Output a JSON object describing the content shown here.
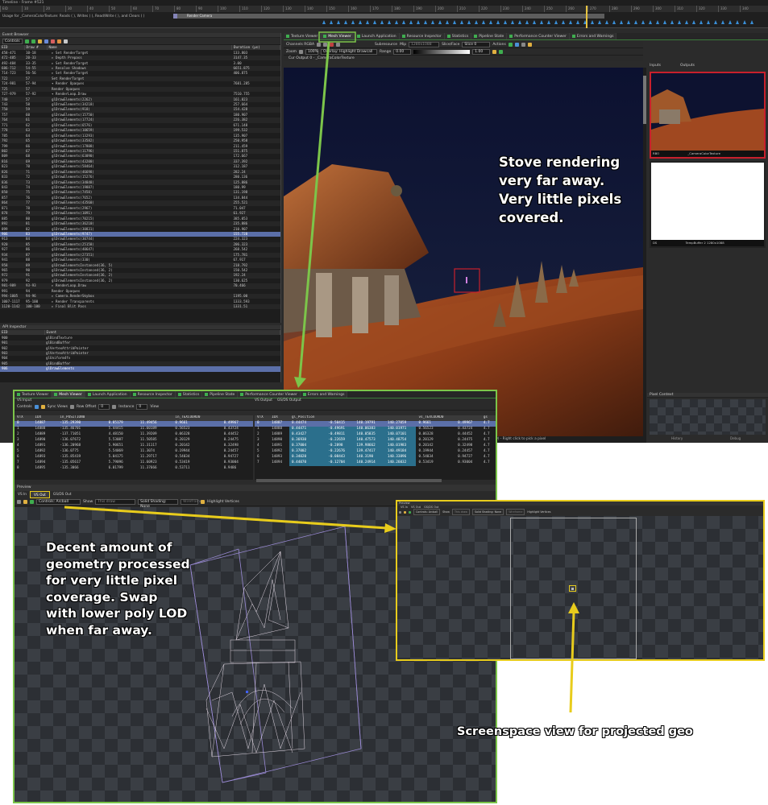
{
  "window": {
    "title": "Timeline - Frame #521",
    "usage_text": "Usage for _CameraColorTexture: Reads ( ), Writes ( ), Read/Write ( ), and Clears ( )",
    "render_camera_label": "Render Camera",
    "ruler_ticks": [
      "EID",
      "10",
      "20",
      "30",
      "40",
      "50",
      "60",
      "70",
      "80",
      "90",
      "100",
      "110",
      "120",
      "130",
      "140",
      "150",
      "160",
      "170",
      "180",
      "190",
      "200",
      "210",
      "220",
      "230",
      "240",
      "250",
      "260",
      "270",
      "280",
      "290",
      "300",
      "310",
      "320",
      "330",
      "340"
    ]
  },
  "event_browser": {
    "title": "Event Browser",
    "controls_label": "Controls",
    "columns": [
      "EID",
      "Draw #",
      "Name",
      "Duration (μs)"
    ],
    "rows": [
      {
        "eid": "458-471",
        "draw": "10-18",
        "name": "▸ Set RenderTarget",
        "dur": "133.803"
      },
      {
        "eid": "472-485",
        "draw": "20-33",
        "name": "▸ Depth Prepass",
        "dur": "3147.35"
      },
      {
        "eid": "492-484",
        "draw": "33-35",
        "name": "▸ Set RenderTarget",
        "dur": "3.00"
      },
      {
        "eid": "686-712",
        "draw": "54-55",
        "name": "▸ Resolve Shadows",
        "dur": "6651.875"
      },
      {
        "eid": "714-723",
        "draw": "56-56",
        "name": "▸ Set RenderTarget",
        "dur": "406.875"
      },
      {
        "eid": "722",
        "draw": "57",
        "name": "Set RenderTarget",
        "dur": ""
      },
      {
        "eid": "724-981",
        "draw": "57-94",
        "name": "▾ Render Opaques",
        "dur": "7681.285"
      },
      {
        "eid": "725",
        "draw": "57",
        "name": "Render Opaques",
        "dur": ""
      },
      {
        "eid": "727-979",
        "draw": "57-92",
        "name": "▾ RenderLoop.Draw",
        "dur": "7510.755"
      },
      {
        "eid": "740",
        "draw": "57",
        "name": "glDrawElements(2262)",
        "dur": "161.823"
      },
      {
        "eid": "743",
        "draw": "58",
        "name": "glDrawElements(34218)",
        "dur": "257.664"
      },
      {
        "eid": "750",
        "draw": "59",
        "name": "glDrawElements(918)",
        "dur": "154.428"
      },
      {
        "eid": "757",
        "draw": "60",
        "name": "glDrawElements(15750)",
        "dur": "180.907"
      },
      {
        "eid": "764",
        "draw": "61",
        "name": "glDrawElements(17724)",
        "dur": "226.382"
      },
      {
        "eid": "771",
        "draw": "62",
        "name": "glDrawElements(6576)",
        "dur": "671.148"
      },
      {
        "eid": "778",
        "draw": "63",
        "name": "glDrawElements(10659)",
        "dur": "199.532"
      },
      {
        "eid": "785",
        "draw": "64",
        "name": "glDrawElements(13293)",
        "dur": "135.907"
      },
      {
        "eid": "792",
        "draw": "65",
        "name": "glDrawElements(33582)",
        "dur": "250.958"
      },
      {
        "eid": "799",
        "draw": "66",
        "name": "glDrawElements(17808)",
        "dur": "211.459"
      },
      {
        "eid": "802",
        "draw": "67",
        "name": "glDrawElements(11796)",
        "dur": "151.875"
      },
      {
        "eid": "809",
        "draw": "68",
        "name": "glDrawElements(63090)",
        "dur": "172.667"
      },
      {
        "eid": "816",
        "draw": "69",
        "name": "glDrawElements(43200)",
        "dur": "337.392"
      },
      {
        "eid": "823",
        "draw": "70",
        "name": "glDrawElements(58464)",
        "dur": "312.187"
      },
      {
        "eid": "826",
        "draw": "71",
        "name": "glDrawElements(46698)",
        "dur": "282.24"
      },
      {
        "eid": "833",
        "draw": "72",
        "name": "glDrawElements(15276)",
        "dur": "280.136"
      },
      {
        "eid": "836",
        "draw": "73",
        "name": "glDrawElements(34848)",
        "dur": "125.886"
      },
      {
        "eid": "843",
        "draw": "74",
        "name": "glDrawElements(19887)",
        "dur": "180.99"
      },
      {
        "eid": "850",
        "draw": "75",
        "name": "glDrawElements(7458)",
        "dur": "131.198"
      },
      {
        "eid": "857",
        "draw": "76",
        "name": "glDrawElements(7652)",
        "dur": "134.844"
      },
      {
        "eid": "864",
        "draw": "77",
        "name": "glDrawElements(43560)",
        "dur": "255.521"
      },
      {
        "eid": "871",
        "draw": "78",
        "name": "glDrawElements(2967)",
        "dur": "71.047"
      },
      {
        "eid": "878",
        "draw": "79",
        "name": "glDrawElements(1091)",
        "dur": "61.927"
      },
      {
        "eid": "885",
        "draw": "80",
        "name": "glDrawElements(70215)",
        "dur": "385.053"
      },
      {
        "eid": "892",
        "draw": "81",
        "name": "glDrawElements(36210)",
        "dur": "235.886"
      },
      {
        "eid": "899",
        "draw": "82",
        "name": "glDrawElements(30831)",
        "dur": "210.907"
      },
      {
        "eid": "906",
        "draw": "83",
        "name": "glDrawElements(9747)",
        "dur": "155.728",
        "selected": true
      },
      {
        "eid": "913",
        "draw": "84",
        "name": "glDrawElements(30744)",
        "dur": "224.323"
      },
      {
        "eid": "920",
        "draw": "85",
        "name": "glDrawElements(25158)",
        "dur": "206.323"
      },
      {
        "eid": "927",
        "draw": "86",
        "name": "glDrawElements(40647)",
        "dur": "268.542"
      },
      {
        "eid": "934",
        "draw": "87",
        "name": "glDrawElements(27351)",
        "dur": "175.781"
      },
      {
        "eid": "941",
        "draw": "88",
        "name": "glDrawElements(330)",
        "dur": "67.917"
      },
      {
        "eid": "958",
        "draw": "89",
        "name": "glDrawElementsInstanced(36, 5)",
        "dur": "218.792"
      },
      {
        "eid": "965",
        "draw": "90",
        "name": "glDrawElementsInstanced(36, 2)",
        "dur": "150.542"
      },
      {
        "eid": "972",
        "draw": "91",
        "name": "glDrawElementsInstanced(36, 2)",
        "dur": "192.24"
      },
      {
        "eid": "979",
        "draw": "92",
        "name": "glDrawElementsInstanced(36, 2)",
        "dur": "130.625"
      },
      {
        "eid": "981-989",
        "draw": "93-93",
        "name": "▸ RenderLoop.Draw",
        "dur": "70.466"
      },
      {
        "eid": "991",
        "draw": "94",
        "name": "Render Opaques",
        "dur": ""
      },
      {
        "eid": "994-1005",
        "draw": "94-96",
        "name": "▸ Camera.RenderSkybox",
        "dur": "1195.00"
      },
      {
        "eid": "1007-1117",
        "draw": "95-100",
        "name": "▸ Render Transparents",
        "dur": "1333.593"
      },
      {
        "eid": "1120-1142",
        "draw": "100-100",
        "name": "▸ Final Blit Pass",
        "dur": "1331.51"
      }
    ]
  },
  "api_inspector": {
    "title": "API Inspector",
    "columns": [
      "EID",
      "Event"
    ],
    "rows": [
      {
        "eid": "900",
        "event": "glBindTexture",
        "selected": false
      },
      {
        "eid": "901",
        "event": "glBindBuffer",
        "selected": false
      },
      {
        "eid": "902",
        "event": "glVertexAttribPointer",
        "selected": false
      },
      {
        "eid": "903",
        "event": "glVertexAttribPointer",
        "selected": false
      },
      {
        "eid": "904",
        "event": "glUniform4fv",
        "selected": false
      },
      {
        "eid": "905",
        "event": "glBindBuffer",
        "selected": false
      },
      {
        "eid": "906",
        "event": "glDrawElements",
        "selected": true
      }
    ]
  },
  "main_tabs": [
    "Texture Viewer",
    "Mesh Viewer",
    "Launch Application",
    "Resource Inspector",
    "Statistics",
    "Pipeline State",
    "Performance Counter Viewer",
    "Errors and Warnings"
  ],
  "texture_viewer": {
    "channels_label": "Channels RGBA",
    "subresource_label": "Subresource",
    "mip_label": "Mip",
    "mip_value": "1280x1088",
    "slice_label": "Slice/Face",
    "slice_value": "Slice 0",
    "actions_label": "Actions",
    "zoom_label": "Zoom",
    "zoom_value": "100%",
    "overlay_label": "Overlay: Highlight Drawcall",
    "range_label": "Range",
    "range_min": "0.00",
    "range_max": "1.00",
    "output_title": "Cur Output 0 - _CameraColorTexture",
    "status_text": "0030, 0.7899) - Right click to pick a pixel",
    "inputs_tab": "Inputs",
    "outputs_tab": "Outputs",
    "thumb1_caption": "_CameraColorTexture",
    "thumb1_label": "RBO",
    "thumb2_caption": "TempBuffer 2 1280x1088",
    "thumb2_label": "DS",
    "pixel_context_title": "Pixel Context",
    "history_button": "History",
    "debug_button": "Debug"
  },
  "mesh_viewer": {
    "vs_input_title": "VS Input",
    "vs_output_title": "VS Output",
    "gs_output_title": "GS/DS Output",
    "controls_label": "Controls",
    "sync_views": "Sync Views",
    "row_offset_label": "Row Offset",
    "row_offset_value": "0",
    "instance_label": "Instance",
    "instance_value": "0",
    "view_label": "View",
    "input_columns": [
      "VTX",
      "IDX",
      "in_POSITION0",
      "",
      "",
      "in_TEXCOORD0",
      ""
    ],
    "input_rows": [
      [
        "0",
        "14887",
        "-135.29390",
        "0.85179",
        "11.49456",
        "0.9661",
        "0.49967"
      ],
      [
        "1",
        "14888",
        "-135.46701",
        "5.44415",
        "11.60189",
        "0.56523",
        "0.43724"
      ],
      [
        "2",
        "14889",
        "-137.71051",
        "4.48150",
        "11.39209",
        "0.06328",
        "0.44452"
      ],
      [
        "3",
        "14890",
        "-136.07672",
        "5.53087",
        "11.50585",
        "0.20129",
        "0.24475"
      ],
      [
        "4",
        "14891",
        "-136.20968",
        "5.90651",
        "11.31117",
        "0.20142",
        "0.32498"
      ],
      [
        "5",
        "14892",
        "-136.0775",
        "5.54069",
        "11.3074",
        "0.19944",
        "0.24457"
      ],
      [
        "6",
        "14893",
        "-135.85419",
        "5.04175",
        "11.29717",
        "0.54034",
        "0.94727"
      ],
      [
        "7",
        "14894",
        "-135.05617",
        "5.79096",
        "11.60923",
        "0.53419",
        "0.93004"
      ],
      [
        "8",
        "14895",
        "-135.3066",
        "6.01799",
        "11.37666",
        "0.53711",
        "0.9486"
      ]
    ],
    "output_columns": [
      "VTX",
      "IDX",
      "gl_Position",
      "",
      "",
      "",
      "vs_TEXCOORD0",
      "",
      "gs"
    ],
    "output_rows": [
      [
        "0",
        "14887",
        "0.44474",
        "-0.50415",
        "140.19791",
        "140.27059",
        "0.9661",
        "0.49967",
        "4.7"
      ],
      [
        "1",
        "14888",
        "0.44471",
        "-0.49691",
        "140.06383",
        "140.01971",
        "0.56523",
        "0.43724",
        "4.7"
      ],
      [
        "2",
        "14889",
        "0.43427",
        "-0.49811",
        "140.05835",
        "140.07101",
        "0.06328",
        "0.44452",
        "4.7"
      ],
      [
        "3",
        "14890",
        "0.36930",
        "-0.22659",
        "140.47573",
        "140.48754",
        "0.20129",
        "0.24475",
        "4.7"
      ],
      [
        "4",
        "14891",
        "0.37004",
        "-0.2898",
        "139.98662",
        "140.01983",
        "0.20142",
        "0.32498",
        "4.7"
      ],
      [
        "5",
        "14892",
        "0.37002",
        "-0.22676",
        "139.47417",
        "140.49184",
        "0.19944",
        "0.24457",
        "4.7"
      ],
      [
        "6",
        "14893",
        "0.34020",
        "-0.08443",
        "140.3190",
        "140.33896",
        "0.54034",
        "0.94727",
        "4.7"
      ],
      [
        "7",
        "14894",
        "0.44070",
        "-0.12704",
        "140.24914",
        "140.26032",
        "0.53419",
        "0.93004",
        "4.7"
      ]
    ],
    "preview_title": "Preview",
    "vs_in_tab": "VS In",
    "vs_out_tab": "VS Out",
    "gs_out_tab": "GS/DS Out",
    "controls_value": "Controls: Arcball",
    "show_label": "Show",
    "show_value": "This draw",
    "solid_shading_label": "Solid Shading: None",
    "wireframe_label": "Wireframe",
    "highlight_verts_label": "Highlight Vertices"
  },
  "callouts": {
    "stove": "Stove rendering very far away. Very little pixels covered.",
    "geometry": "Decent amount of geometry processed for very little pixel coverage. Swap with lower poly LOD when far away.",
    "screenspace": "Screenspace view for projected geo"
  },
  "colors": {
    "green_accent": "#7cc54a",
    "yellow_accent": "#e8cc1c",
    "selection_blue": "#5b6fa8",
    "highlight_red": "#c8202c"
  }
}
